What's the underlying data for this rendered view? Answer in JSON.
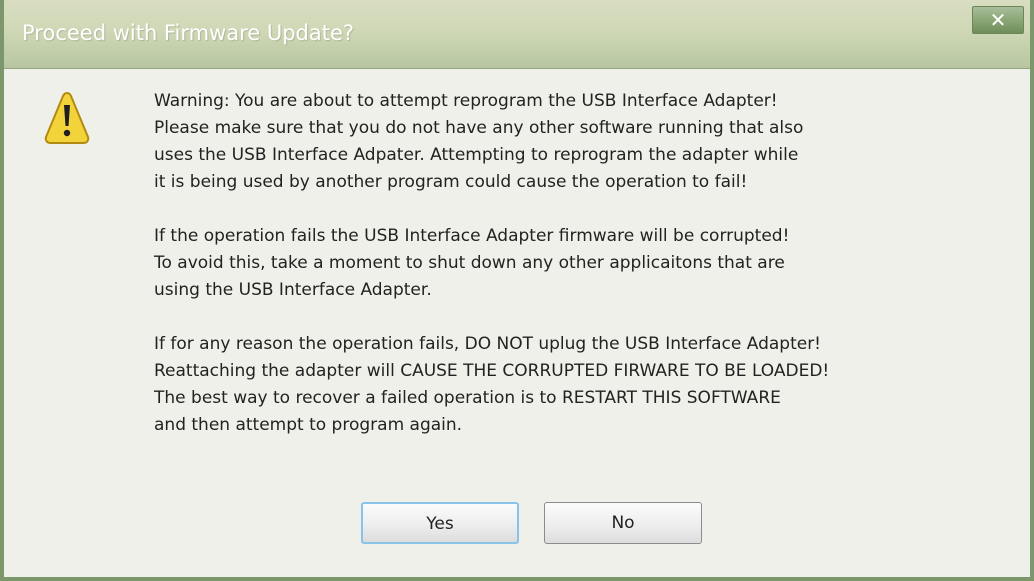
{
  "window": {
    "title": "Proceed with Firmware Update?",
    "close_glyph": "✕"
  },
  "icon": {
    "name": "warning-icon",
    "colors": {
      "fill": "#f2d43a",
      "stroke": "#b38a11",
      "mark": "#1f1f1f"
    }
  },
  "message": {
    "paragraphs": [
      [
        "Warning: You are about to attempt reprogram the USB Interface Adapter!",
        "Please make sure that you do not have any other software running that also",
        "uses the USB Interface Adpater.  Attempting to reprogram the adapter while",
        "it is being used by another program could cause the operation to fail!"
      ],
      [
        "If the operation fails the USB Interface Adapter firmware will be corrupted!",
        "To avoid this, take a moment to shut down any other applicaitons that are",
        "using the USB Interface Adapter."
      ],
      [
        "If for any reason the operation fails, DO NOT uplug the USB Interface Adapter!",
        "Reattaching the adapter will CAUSE THE CORRUPTED FIRWARE TO BE LOADED!",
        "The best way to recover a failed operation is to RESTART THIS SOFTWARE",
        "and then attempt to program again."
      ]
    ]
  },
  "buttons": {
    "yes": "Yes",
    "no": "No"
  }
}
